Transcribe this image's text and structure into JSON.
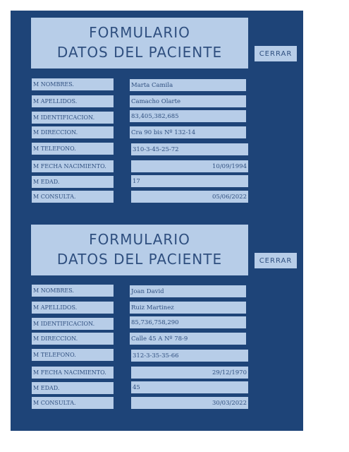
{
  "forms": [
    {
      "title_line1": "FORMULARIO",
      "title_line2": "DATOS DEL PACIENTE",
      "close_label": "CERRAR",
      "fields": [
        {
          "label": "M NOMBRES.",
          "value": "Marta Camila"
        },
        {
          "label": "M APELLIDOS.",
          "value": "Camacho Olarte"
        },
        {
          "label": "M IDENTIFICACION.",
          "value": "83,405,382,685"
        },
        {
          "label": "M DIRECCION.",
          "value": "Cra 90 bis Nº 132-14"
        },
        {
          "label": "M TELEFONO.",
          "value": "310-3-45-25-72"
        },
        {
          "label": "M FECHA NACIMIENTO.",
          "value": "10/09/1994"
        },
        {
          "label": "M EDAD.",
          "value": "17"
        },
        {
          "label": "M CONSULTA.",
          "value": "05/06/2022"
        }
      ]
    },
    {
      "title_line1": "FORMULARIO",
      "title_line2": "DATOS DEL PACIENTE",
      "close_label": "CERRAR",
      "fields": [
        {
          "label": "M NOMBRES.",
          "value": "Joan David"
        },
        {
          "label": "M APELLIDOS.",
          "value": "Ruiz Martinez"
        },
        {
          "label": "M IDENTIFICACION.",
          "value": "85,736,758,290"
        },
        {
          "label": "M DIRECCION.",
          "value": "Calle 45 A Nº 78-9"
        },
        {
          "label": "M TELEFONO.",
          "value": "312-3-35-35-66"
        },
        {
          "label": "M FECHA NACIMIENTO.",
          "value": "29/12/1970"
        },
        {
          "label": "M EDAD.",
          "value": "45"
        },
        {
          "label": "M CONSULTA.",
          "value": "30/03/2022"
        }
      ]
    }
  ],
  "colors": {
    "background": "#1e4478",
    "box": "#b7cde8",
    "text": "#2f4f7f"
  }
}
